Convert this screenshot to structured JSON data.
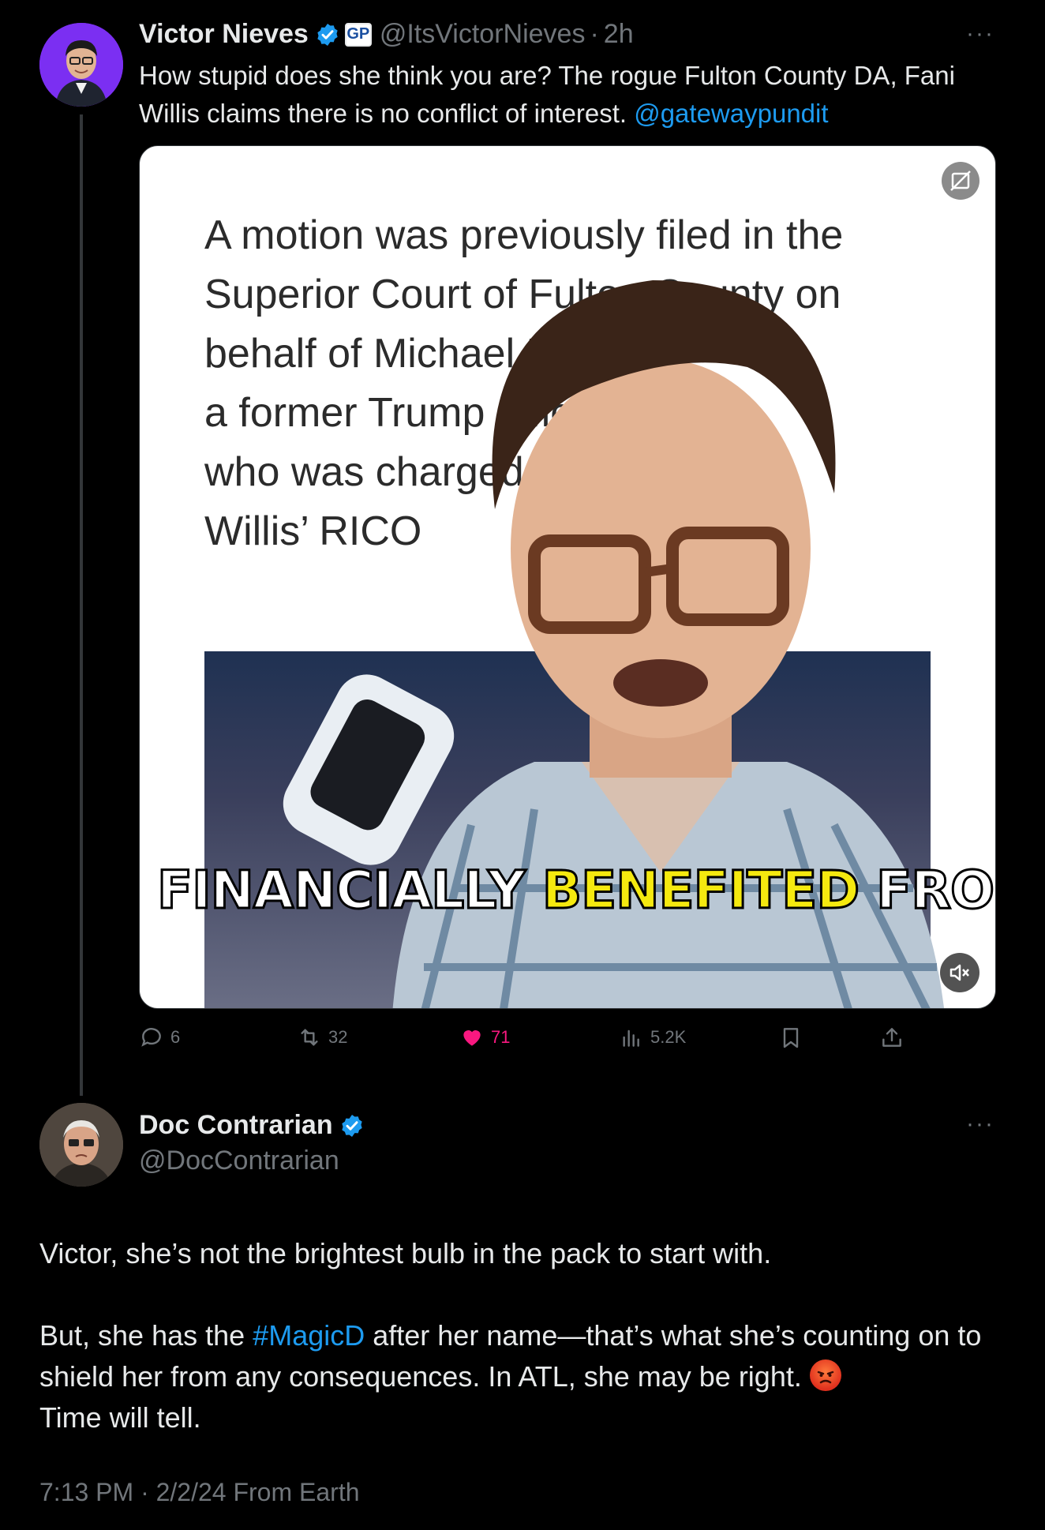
{
  "tweet": {
    "author": {
      "display_name": "Victor Nieves",
      "handle": "@ItsVictorNieves",
      "time": "2h",
      "affiliation_badge": "GP",
      "verified": true
    },
    "more_icon": "···",
    "text": "How stupid does she think you are? The rogue Fulton County DA, Fani Willis claims there is no conflict of interest. ",
    "mention": "@gatewaypundit",
    "media": {
      "document_lines": "A motion was previously filed in the\nSuperior Court of Fulton County on\nbehalf of Michael Roman,\na former Trump official\nwho was charged in Fani\nWillis’ RICO",
      "caption_white_1": "FINANCIALLY ",
      "caption_yellow": "BENEFITED",
      "caption_white_2": " FROM"
    },
    "actions": {
      "replies": "6",
      "retweets": "32",
      "likes": "71",
      "views": "5.2K"
    }
  },
  "reply": {
    "author": {
      "display_name": "Doc Contrarian",
      "handle": "@DocContrarian",
      "verified": true
    },
    "more_icon": "···",
    "text_line1": "Victor, she’s not the brightest bulb in the pack to start with.",
    "text_p2_before": "But, she has the ",
    "hashtag": "#MagicD",
    "text_p2_after": " after her name—that’s what she’s counting on to shield her from any consequences. In ATL, she may be right. ",
    "text_p2_end": "Time will tell.",
    "emoji_name": "angry-face",
    "meta": "7:13 PM · 2/2/24 From Earth"
  },
  "colors": {
    "background": "#000000",
    "text": "#e7e9ea",
    "muted": "#71767b",
    "link": "#1d9bf0",
    "like": "#f91880",
    "caption_yellow": "#f5e90f"
  }
}
